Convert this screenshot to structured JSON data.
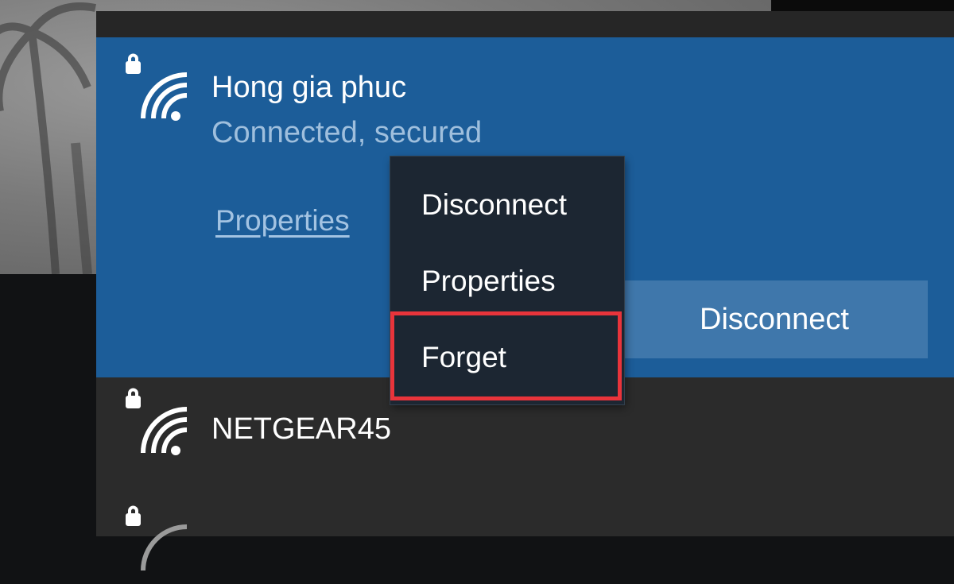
{
  "colors": {
    "panel_bg": "#2b2b2b",
    "selected_bg": "#1c5d99",
    "status_text": "#9fbfdd",
    "link_text": "#a3c3e2",
    "button_bg": "#3f77ab",
    "menu_bg": "#1c2632",
    "highlight": "#e8343b"
  },
  "networks": [
    {
      "name": "Hong gia phuc",
      "status": "Connected, secured",
      "properties_link": "Properties",
      "action_button": "Disconnect",
      "icon": "wifi-secured-icon"
    },
    {
      "name": "NETGEAR45",
      "icon": "wifi-secured-icon"
    },
    {
      "name": "",
      "icon": "wifi-secured-icon"
    }
  ],
  "context_menu": {
    "items": [
      "Disconnect",
      "Properties",
      "Forget"
    ],
    "highlighted_item": "Forget"
  }
}
